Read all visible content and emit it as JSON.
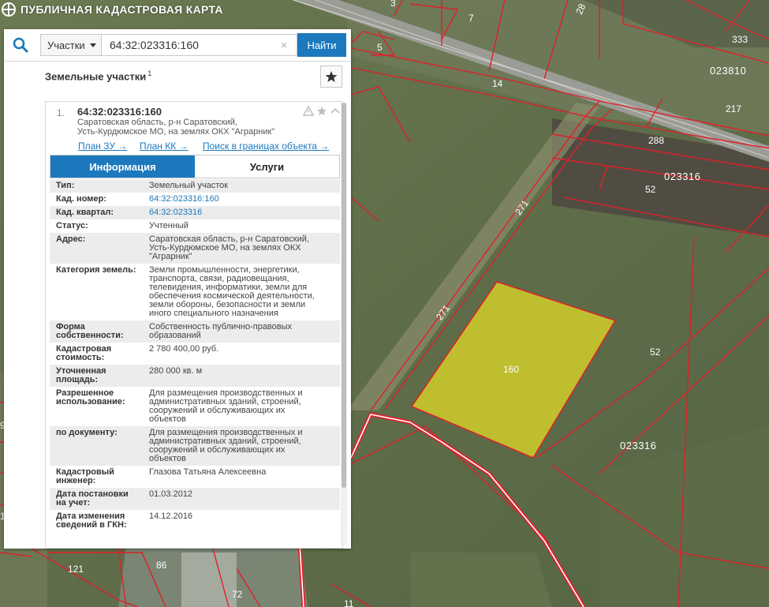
{
  "app": {
    "title": "ПУБЛИЧНАЯ КАДАСТРОВАЯ КАРТА"
  },
  "search": {
    "type_selected": "Участки",
    "query": "64:32:023316:160",
    "clear_symbol": "×",
    "button_label": "Найти"
  },
  "results": {
    "section_title": "Земельные участки",
    "count": "1"
  },
  "result": {
    "number": "1.",
    "cad_number": "64:32:023316:160",
    "address_line1": "Саратовская область, р-н Саратовский,",
    "address_line2": "Усть-Курдюмское МО, на землях ОКХ \"Аграрник\"",
    "links": [
      "План ЗУ →",
      "План КК →",
      "Поиск в границах объекта →"
    ]
  },
  "tabs": [
    {
      "label": "Информация",
      "active": true
    },
    {
      "label": "Услуги",
      "active": false
    }
  ],
  "attributes": [
    {
      "label": [
        "Тип:"
      ],
      "value": [
        "Земельный участок"
      ]
    },
    {
      "label": [
        "Кад. номер:"
      ],
      "value": [
        "64:32:023316:160"
      ],
      "link": true
    },
    {
      "label": [
        "Кад. квартал:"
      ],
      "value": [
        "64:32:023316"
      ],
      "link": true
    },
    {
      "label": [
        "Статус:"
      ],
      "value": [
        "Учтенный"
      ]
    },
    {
      "label": [
        "Адрес:"
      ],
      "value": [
        "Саратовская область, р-н Саратовский,",
        "Усть-Курдюмское МО, на землях ОКХ",
        "\"Аграрник\""
      ]
    },
    {
      "label": [
        "Категория земель:"
      ],
      "value": [
        "Земли промышленности, энергетики,",
        "транспорта, связи, радиовещания,",
        "телевидения, информатики, земли для",
        "обеспечения космической деятельности,",
        "земли обороны, безопасности и земли",
        "иного специального назначения"
      ]
    },
    {
      "label": [
        "Форма",
        "собственности:"
      ],
      "value": [
        "Собственность публично-правовых",
        "образований"
      ]
    },
    {
      "label": [
        "Кадастровая",
        "стоимость:"
      ],
      "value": [
        "2 780 400,00 руб."
      ]
    },
    {
      "label": [
        "Уточненная",
        "площадь:"
      ],
      "value": [
        "280 000 кв. м"
      ]
    },
    {
      "label": [
        "Разрешенное",
        "использование:"
      ],
      "value": [
        "Для размещения производственных и",
        "административных зданий, строений,",
        "сооружений и обслуживающих их",
        "объектов"
      ]
    },
    {
      "label": [
        "по документу:"
      ],
      "value": [
        "Для размещения производственных и",
        "административных зданий, строений,",
        "сооружений и обслуживающих их",
        "объектов"
      ]
    },
    {
      "label": [
        "Кадастровый",
        "инженер:"
      ],
      "value": [
        "Глазова Татьяна Алексеевна"
      ]
    },
    {
      "label": [
        "Дата постановки",
        "на учет:"
      ],
      "value": [
        "01.03.2012"
      ]
    },
    {
      "label": [
        "Дата изменения",
        "сведений в ГКН:"
      ],
      "value": [
        "14.12.2016"
      ]
    }
  ],
  "map": {
    "highlight_label": "160",
    "highlight_color": "#d4d12a",
    "boundary_color": "#e0202a",
    "parcel_labels": [
      "3",
      "7",
      "28",
      "5",
      "333",
      "14",
      "217",
      "288",
      "52",
      "271",
      "271",
      "52",
      "9",
      "121",
      "86",
      "72",
      "11",
      "1",
      "121"
    ],
    "quarter_labels": [
      "023810",
      "023316",
      "023316"
    ]
  }
}
